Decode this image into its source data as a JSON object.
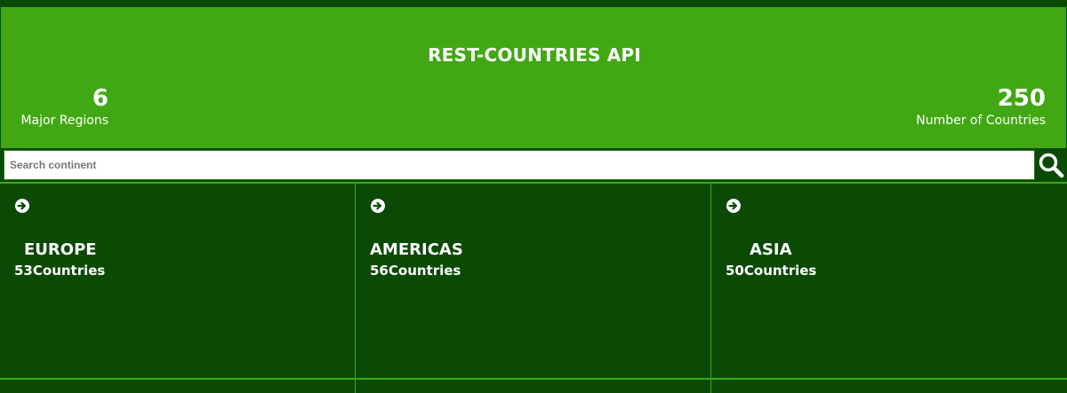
{
  "header": {
    "title": "REST-COUNTRIES API",
    "stats": {
      "regions_value": "6",
      "regions_label": "Major Regions",
      "countries_value": "250",
      "countries_label": "Number of Countries"
    }
  },
  "search": {
    "placeholder": "Search continent",
    "value": "",
    "icon": "search-icon"
  },
  "regions": [
    {
      "name": "EUROPE",
      "count": "53",
      "suffix": "Countries",
      "icon": "arrow-circle-right-icon"
    },
    {
      "name": "AMERICAS",
      "count": "56",
      "suffix": "Countries",
      "icon": "arrow-circle-right-icon"
    },
    {
      "name": "ASIA",
      "count": "50",
      "suffix": "Countries",
      "icon": "arrow-circle-right-icon"
    }
  ],
  "colors": {
    "header_bg": "#41a814",
    "card_bg": "#0a4a04",
    "text": "#ffffff"
  }
}
